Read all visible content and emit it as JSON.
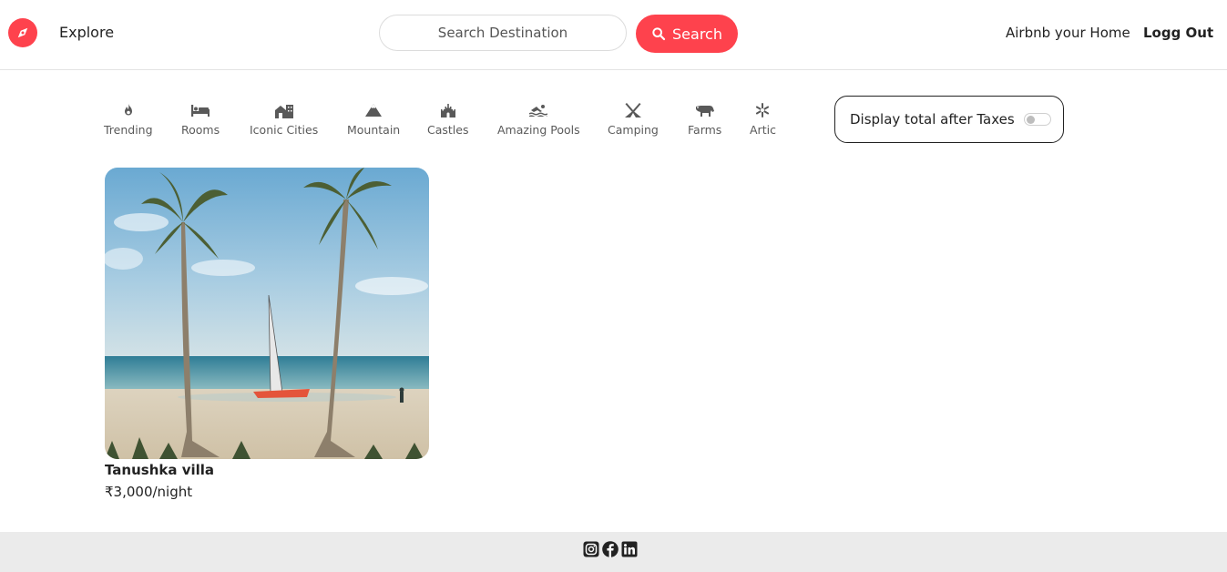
{
  "nav": {
    "brand_icon": "compass-icon",
    "explore_label": "Explore",
    "search_placeholder": "Search Destination",
    "search_button_label": "Search",
    "host_label": "Airbnb your Home",
    "logout_label": "Logg Out"
  },
  "filters": [
    {
      "icon": "fire-icon",
      "label": "Trending"
    },
    {
      "icon": "bed-icon",
      "label": "Rooms"
    },
    {
      "icon": "city-icon",
      "label": "Iconic Cities"
    },
    {
      "icon": "mountain-icon",
      "label": "Mountain"
    },
    {
      "icon": "castle-icon",
      "label": "Castles"
    },
    {
      "icon": "swimmer-icon",
      "label": "Amazing Pools"
    },
    {
      "icon": "tent-icon",
      "label": "Camping"
    },
    {
      "icon": "cow-icon",
      "label": "Farms"
    },
    {
      "icon": "snowflake-icon",
      "label": "Artic"
    }
  ],
  "tax_toggle": {
    "label": "Display total after Taxes",
    "enabled": false
  },
  "listings": [
    {
      "title": "Tanushka villa",
      "price": "₹3,000/night"
    }
  ],
  "footer": {
    "socials": [
      "instagram-icon",
      "facebook-icon",
      "linkedin-icon"
    ]
  },
  "colors": {
    "brand": "#fe424d",
    "footer_bg": "#ebebeb"
  }
}
